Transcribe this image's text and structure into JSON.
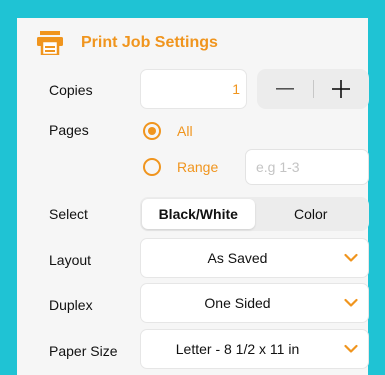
{
  "header": {
    "title": "Print Job Settings",
    "icon": "printer-icon",
    "accent": "#f0951e"
  },
  "copies": {
    "label": "Copies",
    "value": "1",
    "minus": "—",
    "plus": "+"
  },
  "pages": {
    "label": "Pages",
    "options": [
      {
        "label": "All",
        "selected": true
      },
      {
        "label": "Range",
        "selected": false
      }
    ],
    "range_placeholder": "e.g 1-3"
  },
  "select": {
    "label": "Select",
    "options": [
      "Black/White",
      "Color"
    ],
    "selected": "Black/White"
  },
  "layout": {
    "label": "Layout",
    "value": "As Saved"
  },
  "duplex": {
    "label": "Duplex",
    "value": "One Sided"
  },
  "paper": {
    "label": "Paper Size",
    "value": "Letter - 8 1/2 x 11 in"
  },
  "colors": {
    "background": "#1fc3d4",
    "panel": "#f6f6f6",
    "accent": "#f0951e"
  }
}
